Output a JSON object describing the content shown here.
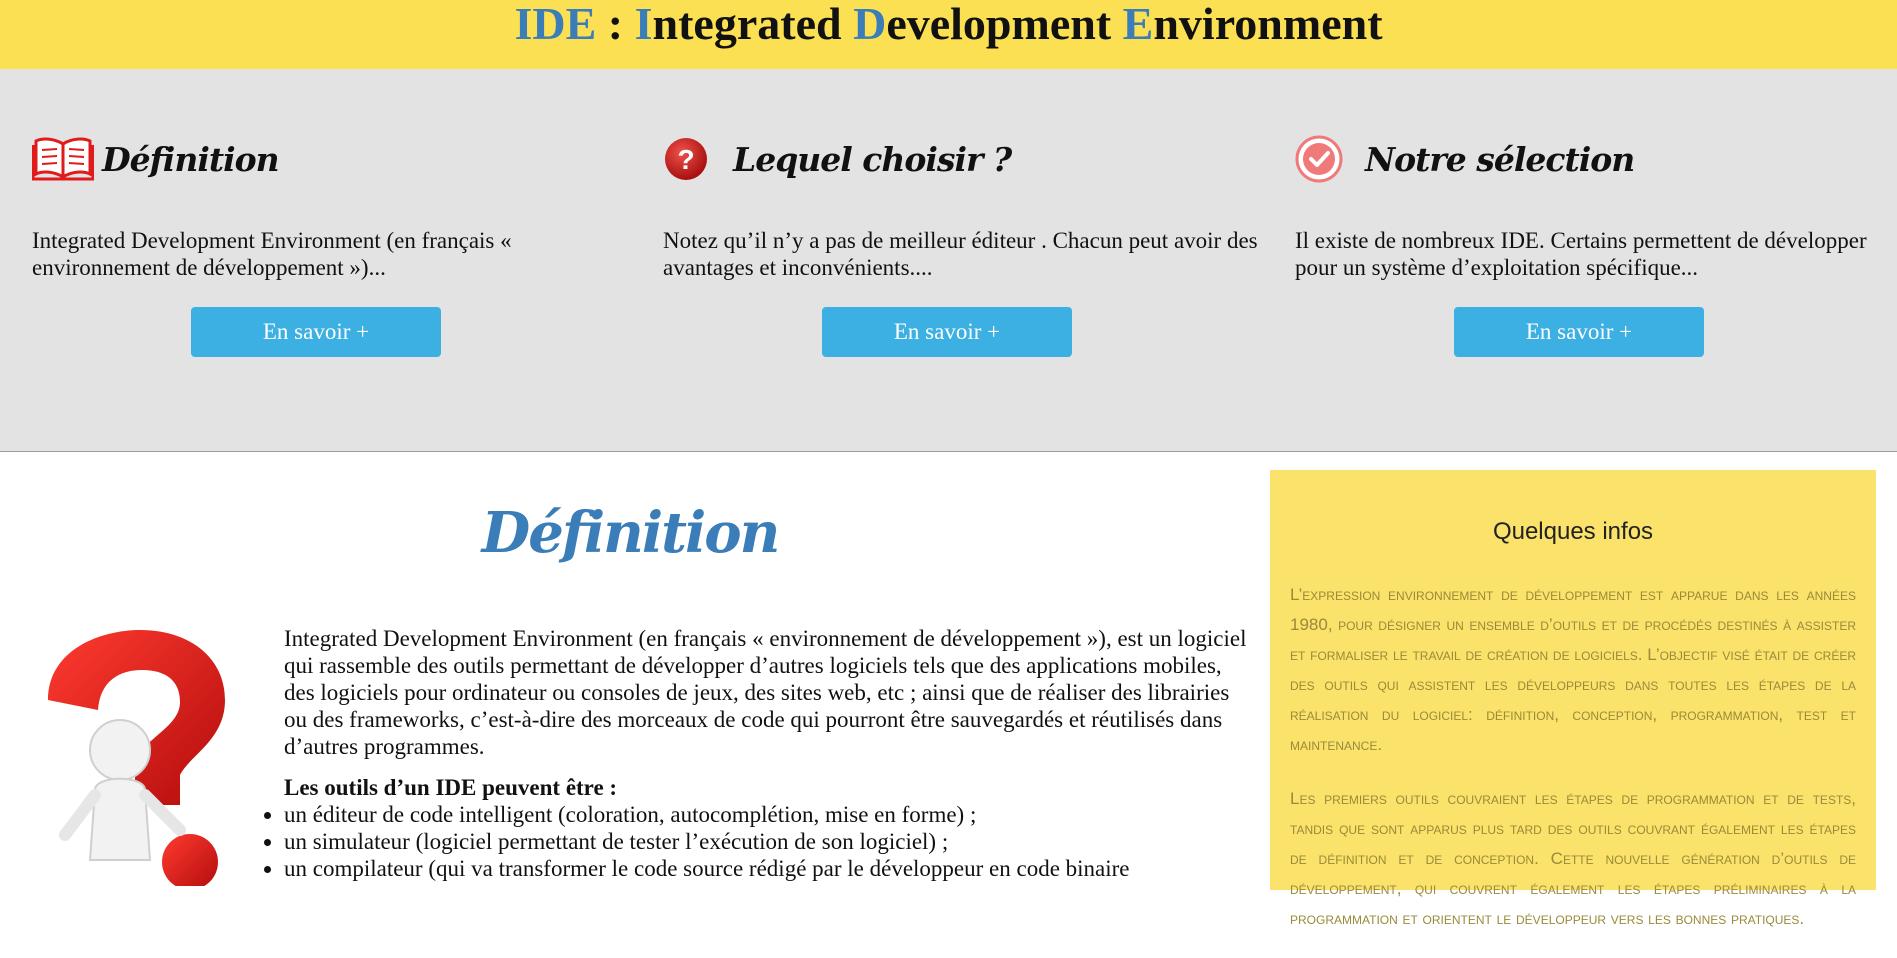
{
  "header": {
    "title_parts": [
      "IDE",
      " : ",
      "I",
      "ntegrated ",
      "D",
      "evelopment ",
      "E",
      "nvironment"
    ]
  },
  "features": [
    {
      "icon": "open-book-icon",
      "title": "Définition",
      "text": "Integrated Development Environment (en français « environnement de développement »)...",
      "button": "En savoir +"
    },
    {
      "icon": "question-circle-icon",
      "title": "Lequel choisir ?",
      "text": "Notez qu’il n’y a pas de meilleur éditeur . Chacun peut avoir des avantages et inconvénients....",
      "button": "En savoir +"
    },
    {
      "icon": "check-circle-icon",
      "title": "Notre sélection",
      "text": "Il existe de nombreux IDE. Certains permettent de développer pour un système d’exploitation spécifique...",
      "button": "En savoir +"
    }
  ],
  "main": {
    "title": "Définition",
    "intro": "Integrated Development Environment (en français « environnement de développement »), est un logiciel qui rassemble des outils permettant de développer d’autres logiciels tels que des applications mobiles, des logiciels pour ordinateur ou consoles de jeux, des sites web, etc ; ainsi que de réaliser des librairies ou des frameworks, c’est-à-dire des morceaux de code qui pourront être sauvegardés et réutilisés dans d’autres programmes.",
    "tools_heading": "Les outils d’un IDE peuvent être :",
    "tools": [
      "un éditeur de code intelligent (coloration, autocomplétion, mise en forme) ;",
      "un simulateur (logiciel permettant de tester l’exécution de son logiciel) ;",
      "un compilateur (qui va transformer le code source rédigé par le développeur en code binaire"
    ]
  },
  "aside": {
    "title": "Quelques infos",
    "paragraphs": [
      "L’expression environnement de développement est apparue dans les années 1980, pour désigner un ensemble d’outils et de procédés destinés à assister et formaliser le travail de création de logiciels. L’objectif visé était de créer des outils qui assistent les développeurs dans toutes les étapes de la réalisation du logiciel: définition, conception, programmation, test et maintenance.",
      "Les premiers outils couvraient les étapes de programmation et de tests, tandis que sont apparus plus tard des outils couvrant également les étapes de définition et de conception. Cette nouvelle génération d’outils de développement, qui couvrent également les étapes préliminaires à la programmation et orientent le développeur vers les bonnes pratiques."
    ]
  },
  "colors": {
    "header_bg": "#fbe053",
    "accent_blue": "#3a7db8",
    "button_bg": "#3cb0e2",
    "band_bg": "#e3e3e3",
    "aside_bg": "#fbe26a"
  }
}
